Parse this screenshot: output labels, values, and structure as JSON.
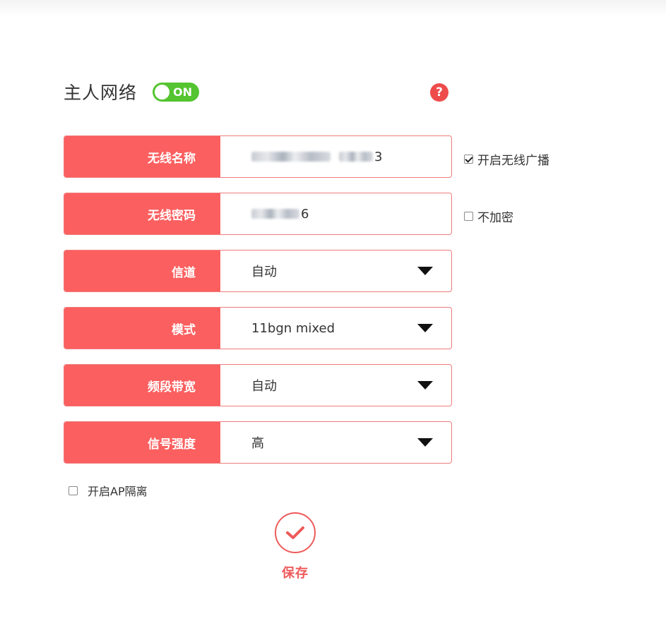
{
  "header": {
    "title": "主人网络",
    "toggle_label": "ON",
    "help_icon": "?"
  },
  "fields": {
    "ssid": {
      "label": "无线名称",
      "value_tail": "3"
    },
    "password": {
      "label": "无线密码",
      "value_tail": "6"
    },
    "channel": {
      "label": "信道",
      "value": "自动"
    },
    "mode": {
      "label": "模式",
      "value": "11bgn mixed"
    },
    "bandwidth": {
      "label": "频段带宽",
      "value": "自动"
    },
    "signal": {
      "label": "信号强度",
      "value": "高"
    }
  },
  "options": {
    "broadcast": {
      "label": "开启无线广播",
      "checked": true
    },
    "no_encrypt": {
      "label": "不加密",
      "checked": false
    },
    "ap_isolation": {
      "label": "开启AP隔离",
      "checked": false
    }
  },
  "save": {
    "label": "保存"
  },
  "colors": {
    "accent": "#fb5f5f",
    "toggle_on": "#54c430",
    "help": "#ee4b4b"
  }
}
